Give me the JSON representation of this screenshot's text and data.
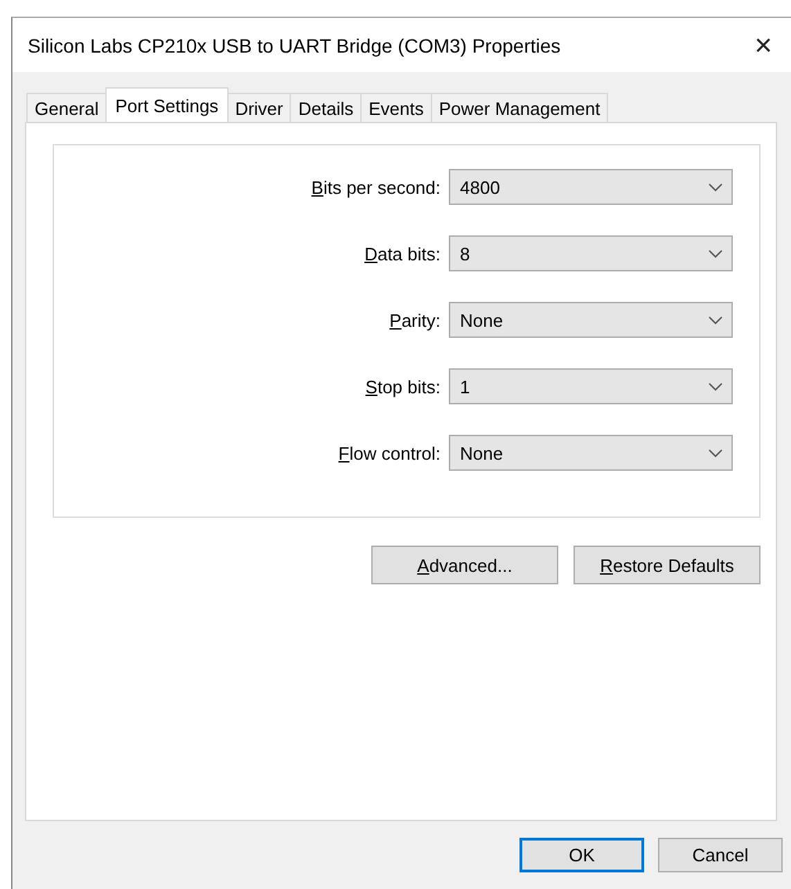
{
  "window": {
    "title": "Silicon Labs CP210x USB to UART Bridge (COM3) Properties",
    "close": "×"
  },
  "tabs": [
    {
      "label": "General",
      "selected": false
    },
    {
      "label": "Port Settings",
      "selected": true
    },
    {
      "label": "Driver",
      "selected": false
    },
    {
      "label": "Details",
      "selected": false
    },
    {
      "label": "Events",
      "selected": false
    },
    {
      "label": "Power Management",
      "selected": false
    }
  ],
  "settings": [
    {
      "label": "Bits per second:",
      "access_key_underlined": true,
      "value": "4800"
    },
    {
      "label": "Data bits:",
      "access_key_underlined": true,
      "value": "8"
    },
    {
      "label": "Parity:",
      "access_key_underlined": true,
      "value": "None"
    },
    {
      "label": "Stop bits:",
      "access_key_underlined": true,
      "value": "1"
    },
    {
      "label": "Flow control:",
      "access_key_underlined": true,
      "value": "None"
    }
  ],
  "panel_buttons": [
    {
      "label": "Advanced...",
      "access_key_underlined": true
    },
    {
      "label": "Restore Defaults",
      "access_key_underlined": true
    }
  ],
  "dialog_buttons": [
    {
      "label": "OK",
      "default": true
    },
    {
      "label": "Cancel",
      "default": false
    }
  ]
}
